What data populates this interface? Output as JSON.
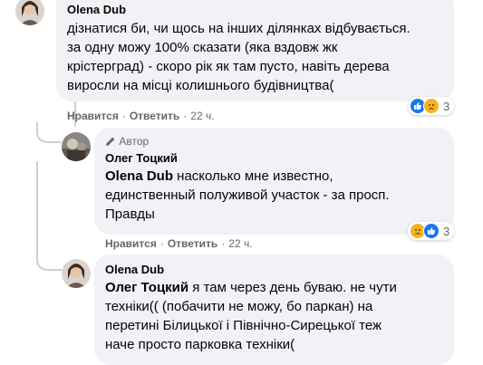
{
  "comments": [
    {
      "author": "Olena Dub",
      "text": "дізнатися би, чи щось на інших ділянках відбувається.\nза одну можу 100% сказати (яка вздовж жк\nкрістерград) - скоро рік як там пусто, навіть дерева\nвиросли на місці колишнього будівництва(",
      "actions": {
        "like": "Нравится",
        "reply": "Ответить",
        "time": "22 ч."
      },
      "reaction_count": "3",
      "reaction_icons": [
        "like-icon",
        "sad-icon"
      ]
    },
    {
      "author": "Олег Тоцкий",
      "badge": "Автор",
      "mention": "Olena Dub",
      "text": " насколько мне известно,\nединственный полуживой участок - за просп.\nПравды",
      "actions": {
        "like": "Нравится",
        "reply": "Ответить",
        "time": "22 ч."
      },
      "reaction_count": "3",
      "reaction_icons": [
        "sad-icon",
        "like-icon"
      ]
    },
    {
      "author": "Olena Dub",
      "mention": "Олег Тоцкий",
      "text": " я там через день буваю. не чути\nтехніки(( (побачити не можу, бо паркан) на\nперетині Білицької і Північно-Сирецької теж\nначе просто парковка техніки("
    }
  ],
  "colors": {
    "bubble": "#f0f2f5",
    "like": "#1877f2",
    "sad": "#f7b125",
    "secondary_text": "#65676b"
  }
}
